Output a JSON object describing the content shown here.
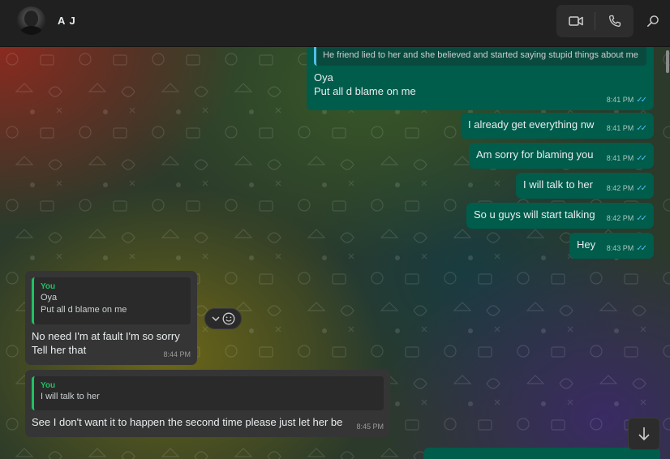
{
  "header": {
    "contact_name": "A J",
    "avatar_icon": "avatar-photo",
    "video_call_icon": "video-camera-icon",
    "voice_call_icon": "phone-icon",
    "search_icon": "search-icon"
  },
  "colors": {
    "outgoing_bubble": "#005c4b",
    "incoming_bubble": "#353535",
    "read_ticks": "#53bdeb",
    "quote_author": "#21c063"
  },
  "messages": [
    {
      "direction": "out",
      "quote_text": "He friend lied to her and she believed and started saying stupid things about me",
      "text": "Oya\nPut all d blame on me",
      "time": "8:41 PM",
      "status": "read"
    },
    {
      "direction": "out",
      "text": "I already get everything nw",
      "time": "8:41 PM",
      "status": "read"
    },
    {
      "direction": "out",
      "text": "Am sorry for blaming you",
      "time": "8:41 PM",
      "status": "read"
    },
    {
      "direction": "out",
      "text": "I will talk to her",
      "time": "8:42 PM",
      "status": "read"
    },
    {
      "direction": "out",
      "text": "So u guys will start talking",
      "time": "8:42 PM",
      "status": "read"
    },
    {
      "direction": "out",
      "text": "Hey",
      "time": "8:43 PM",
      "status": "read"
    },
    {
      "direction": "in",
      "quote_author": "You",
      "quote_text": "Oya\nPut all d blame on me",
      "text": "No need I'm at fault I'm so sorry\nTell her that",
      "time": "8:44 PM"
    },
    {
      "direction": "in",
      "quote_author": "You",
      "quote_text": "I will talk to her",
      "text": "See I don't want it to happen the second time please just let her be",
      "time": "8:45 PM"
    }
  ],
  "message_actions": {
    "chevron_icon": "chevron-down-icon",
    "emoji_icon": "emoji-icon"
  },
  "scroll_down_icon": "arrow-down-icon"
}
